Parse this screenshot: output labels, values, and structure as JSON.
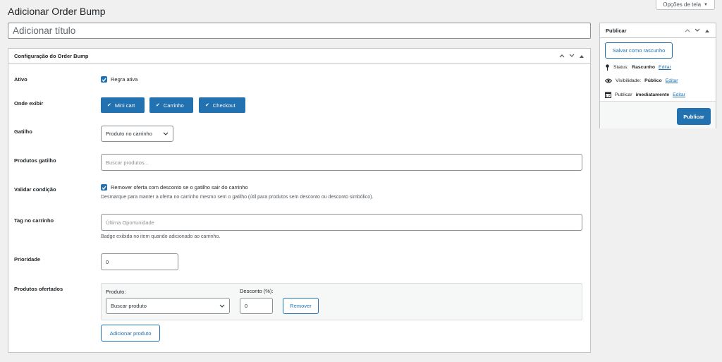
{
  "screen_options": {
    "label": "Opções de tela",
    "caret": "▼"
  },
  "page_title": "Adicionar Order Bump",
  "title_input": {
    "placeholder": "Adicionar título",
    "value": ""
  },
  "config_box": {
    "title": "Configuração do Order Bump",
    "fields": {
      "ativo": {
        "label": "Ativo",
        "checkbox_label": "Regra ativa",
        "checked": true
      },
      "onde_exibir": {
        "label": "Onde exibir",
        "options": [
          {
            "label": "Mini cart",
            "selected": true
          },
          {
            "label": "Carrinho",
            "selected": true
          },
          {
            "label": "Checkout",
            "selected": true
          }
        ]
      },
      "gatilho": {
        "label": "Gatilho",
        "selected": "Produto no carrinho"
      },
      "produtos_gatilho": {
        "label": "Produtos gatilho",
        "placeholder": "Buscar produtos..."
      },
      "validar_condicao": {
        "label": "Validar condição",
        "checkbox_label": "Remover oferta com desconto se o gatilho sair do carrinho",
        "checked": true,
        "help": "Desmarque para manter a oferta no carrinho mesmo sem o gatilho (útil para produtos sem desconto ou desconto simbólico)."
      },
      "tag_carrinho": {
        "label": "Tag no carrinho",
        "placeholder": "Última Oportunidade",
        "help": "Badge exibida no item quando adicionado ao carrinho."
      },
      "prioridade": {
        "label": "Prioridade",
        "value": "0"
      },
      "produtos_ofertados": {
        "label": "Produtos ofertados",
        "produto_label": "Produto:",
        "produto_selected": "Buscar produto",
        "desconto_label": "Desconto (%):",
        "desconto_value": "0",
        "remove_label": "Remover",
        "add_label": "Adicionar produto"
      }
    }
  },
  "publish_box": {
    "title": "Publicar",
    "save_draft": "Salvar como rascunho",
    "status_label": "Status:",
    "status_value": "Rascunho",
    "visibility_label": "Visibilidade:",
    "visibility_value": "Público",
    "publish_label": "Publicar",
    "publish_value": "imediatamente",
    "edit_label": "Editar",
    "publish_button": "Publicar"
  },
  "colors": {
    "primary": "#2271b1",
    "background": "#f0f0f1",
    "border": "#c3c4c7"
  },
  "icons": [
    "chevron-up-icon",
    "chevron-down-icon",
    "arrow-up-icon",
    "pin-icon",
    "eye-icon",
    "calendar-icon",
    "check-icon"
  ]
}
